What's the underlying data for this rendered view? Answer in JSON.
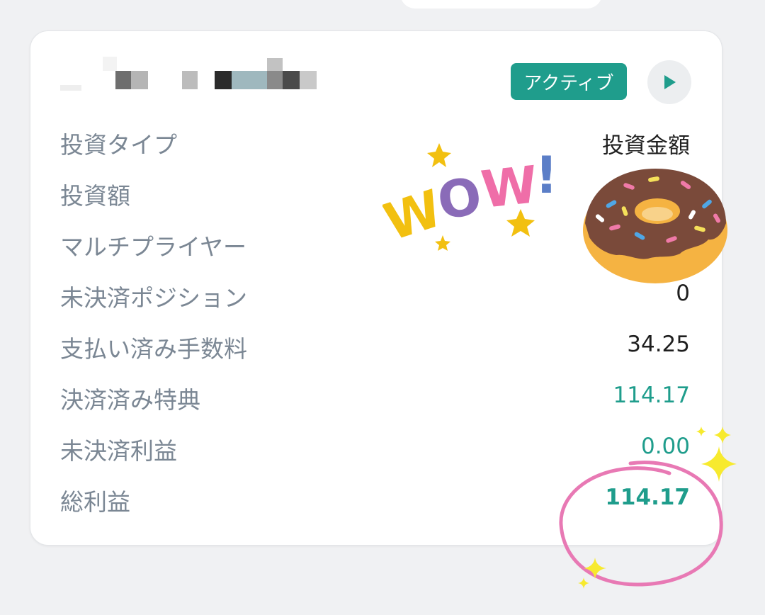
{
  "header": {
    "status_badge": "アクティブ",
    "play_icon": "play-icon"
  },
  "rows": [
    {
      "label": "投資タイプ",
      "value": "投資金額"
    },
    {
      "label": "投資額",
      "value": ""
    },
    {
      "label": "マルチプライヤー",
      "value": ""
    },
    {
      "label": "未決済ポジション",
      "value": "0"
    },
    {
      "label": "支払い済み手数料",
      "value": "34.25"
    },
    {
      "label": "決済済み特典",
      "value": "114.17"
    },
    {
      "label": "未決済利益",
      "value": "0.00"
    },
    {
      "label": "総利益",
      "value": "114.17"
    }
  ],
  "colors": {
    "accent": "#1f9d8c",
    "label": "#7b8794",
    "background": "#f0f1f3"
  },
  "stickers": {
    "wow_text": "WOW!",
    "donut": "donut-sticker",
    "sparkles": "sparkle-icon",
    "circle": "pink-circle-annotation"
  }
}
